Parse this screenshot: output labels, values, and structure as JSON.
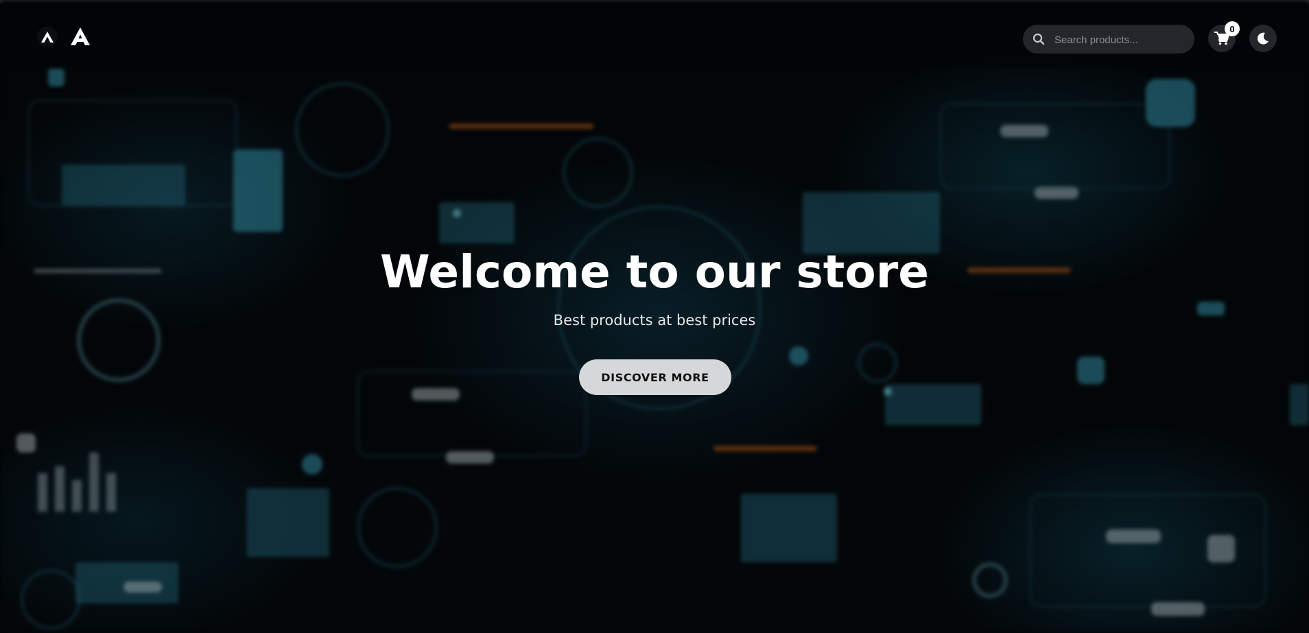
{
  "header": {
    "logo_small_letter": "A",
    "logo_large_letter": "A",
    "search": {
      "placeholder": "Search products...",
      "value": ""
    },
    "cart": {
      "count": "0",
      "icon": "cart-icon"
    },
    "theme_toggle": {
      "icon": "moon-icon"
    }
  },
  "hero": {
    "title": "Welcome to our store",
    "subtitle": "Best products at best prices",
    "cta_label": "DISCOVER MORE"
  },
  "colors": {
    "header_bg": "#020608",
    "accent_cyan": "#46bedc",
    "button_bg": "#d6d7d9",
    "search_bg": "#23262a"
  }
}
